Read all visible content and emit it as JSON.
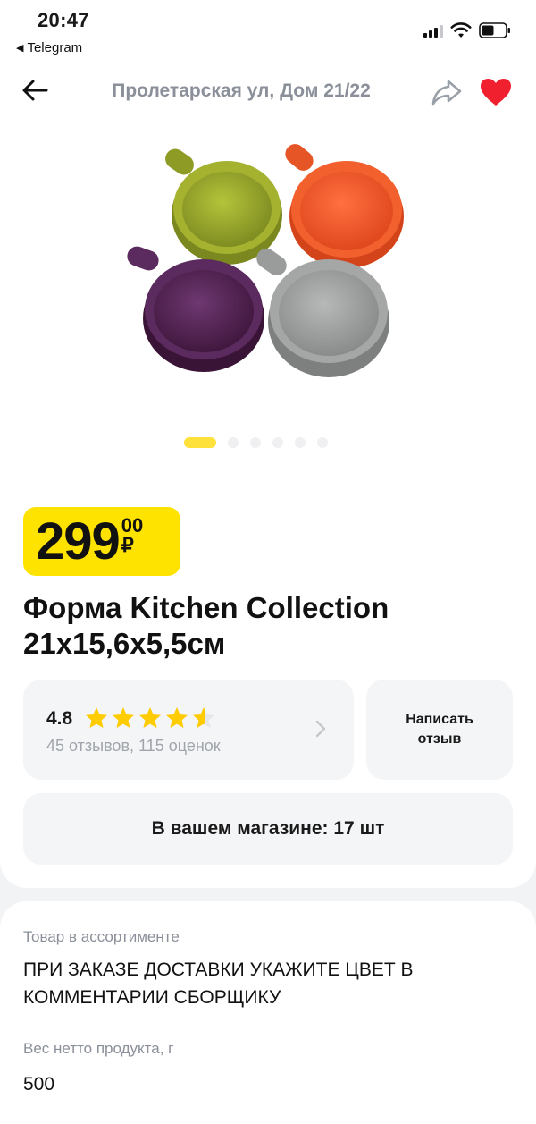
{
  "status_bar": {
    "time": "20:47",
    "back_app": "Telegram",
    "back_arrow_glyph": "◀"
  },
  "nav": {
    "title": "Пролетарская ул, Дом 21/22",
    "icons": [
      "arrow-left-icon",
      "share-icon",
      "heart-icon"
    ],
    "favorite_color": "#f0202e"
  },
  "gallery": {
    "image_count": 6,
    "active_index": 0,
    "product_colors": [
      "#9aa92c",
      "#ee5a2c",
      "#5b2a5e",
      "#9a9c9c"
    ]
  },
  "price": {
    "main": "299",
    "cents": "00",
    "currency": "₽",
    "badge_color": "#ffe300"
  },
  "product": {
    "title_line1": "Форма Kitchen Collection",
    "title_line2": "21х15,6х5,5см"
  },
  "rating": {
    "value": "4.8",
    "stars": 4.8,
    "star_color": "#ffcc00",
    "meta": "45 отзывов, 115 оценок"
  },
  "review": {
    "label": "Написать отзыв"
  },
  "store": {
    "text": "В вашем магазине: 17 шт"
  },
  "details": {
    "assortment_label": "Товар в ассортименте",
    "assortment_value": "ПРИ ЗАКАЗЕ ДОСТАВКИ УКАЖИТЕ ЦВЕТ В КОММЕНТАРИИ СБОРЩИКУ",
    "weight_label": "Вес нетто продукта, г",
    "weight_value": "500"
  }
}
